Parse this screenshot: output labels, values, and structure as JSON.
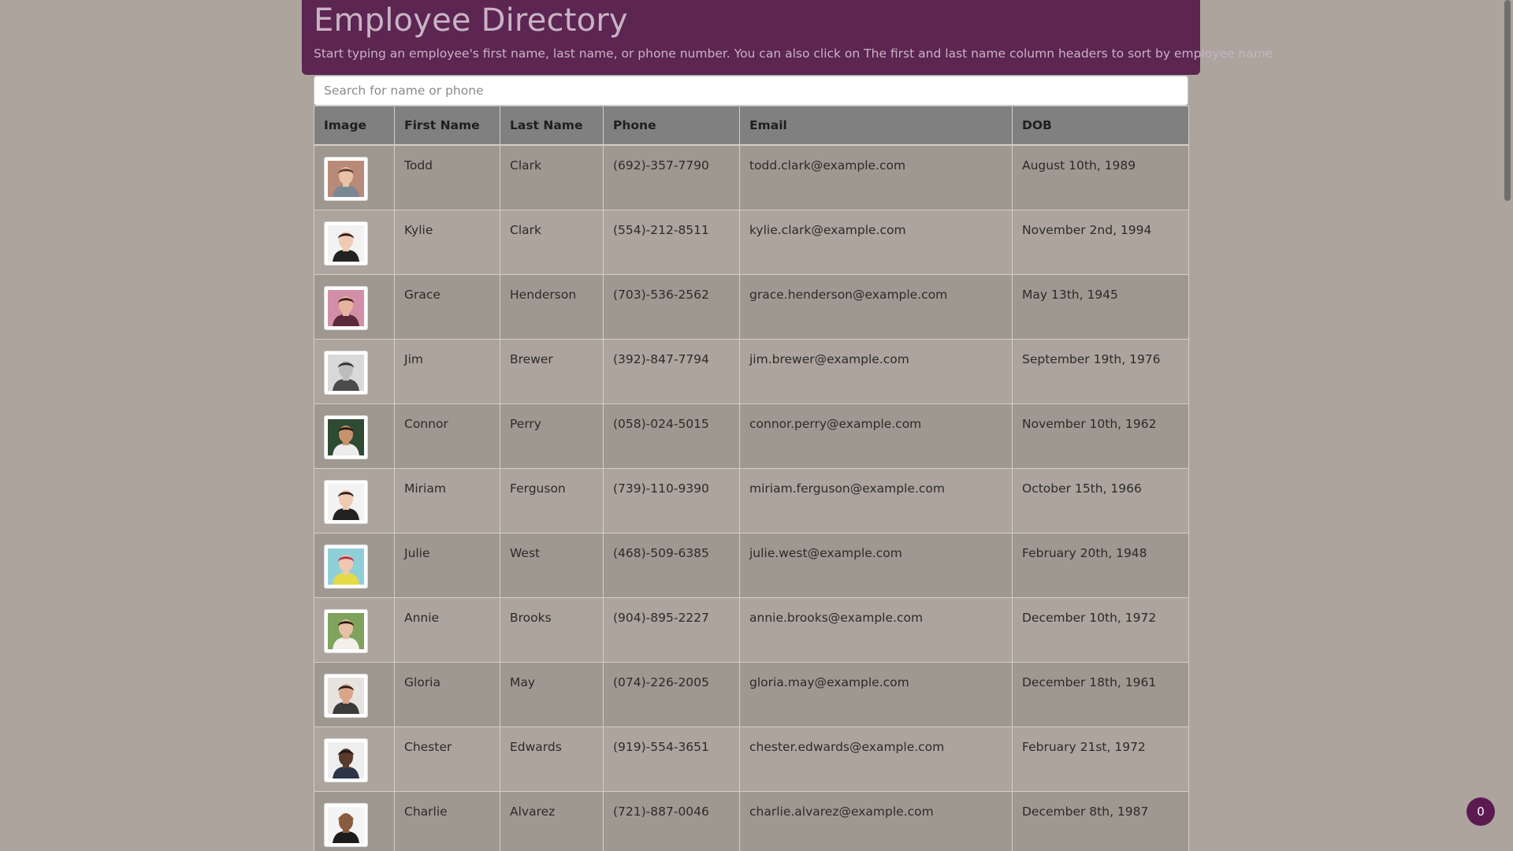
{
  "header": {
    "title": "Employee Directory",
    "subtitle": "Start typing an employee's first name, last name, or phone number. You can also click on The first and last name column headers to sort by employee name"
  },
  "search": {
    "placeholder": "Search for name or phone",
    "value": ""
  },
  "table": {
    "columns": [
      "Image",
      "First Name",
      "Last Name",
      "Phone",
      "Email",
      "DOB"
    ],
    "rows": [
      {
        "first": "Todd",
        "last": "Clark",
        "phone": "(692)-357-7790",
        "email": "todd.clark@example.com",
        "dob": "August 10th, 1989",
        "avatar": {
          "bg": "#b98a78",
          "skin": "#e8c3a8",
          "hair": "#5a3f2c",
          "shirt": "#7b8894"
        }
      },
      {
        "first": "Kylie",
        "last": "Clark",
        "phone": "(554)-212-8511",
        "email": "kylie.clark@example.com",
        "dob": "November 2nd, 1994",
        "avatar": {
          "bg": "#f2f2f2",
          "skin": "#f0c9b3",
          "hair": "#2a1d17",
          "shirt": "#222222"
        }
      },
      {
        "first": "Grace",
        "last": "Henderson",
        "phone": "(703)-536-2562",
        "email": "grace.henderson@example.com",
        "dob": "May 13th, 1945",
        "avatar": {
          "bg": "#d48fa8",
          "skin": "#e6b59f",
          "hair": "#3a2219",
          "shirt": "#5a2a3a"
        }
      },
      {
        "first": "Jim",
        "last": "Brewer",
        "phone": "(392)-847-7794",
        "email": "jim.brewer@example.com",
        "dob": "September 19th, 1976",
        "avatar": {
          "bg": "#d9d9d9",
          "skin": "#bdbdbd",
          "hair": "#2f2f2f",
          "shirt": "#4a4a4a"
        }
      },
      {
        "first": "Connor",
        "last": "Perry",
        "phone": "(058)-024-5015",
        "email": "connor.perry@example.com",
        "dob": "November 10th, 1962",
        "avatar": {
          "bg": "#2f4a32",
          "skin": "#c9926e",
          "hair": "#1e1a17",
          "shirt": "#ececec"
        }
      },
      {
        "first": "Miriam",
        "last": "Ferguson",
        "phone": "(739)-110-9390",
        "email": "miriam.ferguson@example.com",
        "dob": "October 15th, 1966",
        "avatar": {
          "bg": "#f2f2f2",
          "skin": "#f0c9b3",
          "hair": "#2a1d17",
          "shirt": "#222222"
        }
      },
      {
        "first": "Julie",
        "last": "West",
        "phone": "(468)-509-6385",
        "email": "julie.west@example.com",
        "dob": "February 20th, 1948",
        "avatar": {
          "bg": "#8fd0d8",
          "skin": "#f0c7b0",
          "hair": "#b0334d",
          "shirt": "#e6d94a"
        }
      },
      {
        "first": "Annie",
        "last": "Brooks",
        "phone": "(904)-895-2227",
        "email": "annie.brooks@example.com",
        "dob": "December 10th, 1972",
        "avatar": {
          "bg": "#7fa35c",
          "skin": "#e8c0a3",
          "hair": "#2b1d15",
          "shirt": "#f3f0ec"
        }
      },
      {
        "first": "Gloria",
        "last": "May",
        "phone": "(074)-226-2005",
        "email": "gloria.may@example.com",
        "dob": "December 18th, 1961",
        "avatar": {
          "bg": "#e7e4e0",
          "skin": "#d9a58a",
          "hair": "#2d1e1a",
          "shirt": "#3a3a3a"
        }
      },
      {
        "first": "Chester",
        "last": "Edwards",
        "phone": "(919)-554-3651",
        "email": "chester.edwards@example.com",
        "dob": "February 21st, 1972",
        "avatar": {
          "bg": "#eeeeee",
          "skin": "#5a3a28",
          "hair": "#1a1a1a",
          "shirt": "#2c3448"
        }
      },
      {
        "first": "Charlie",
        "last": "Alvarez",
        "phone": "(721)-887-0046",
        "email": "charlie.alvarez@example.com",
        "dob": "December 8th, 1987",
        "avatar": {
          "bg": "#f4f4f4",
          "skin": "#8a5b3e",
          "hair": "#8a5b3e",
          "shirt": "#1c1c1c"
        }
      }
    ]
  },
  "badge": {
    "count": "0",
    "color": "#5c1a50"
  },
  "colors": {
    "header_bg": "#5c2552",
    "header_text": "#c9b3c4",
    "page_bg": "#aca49d",
    "table_head_bg": "#808080"
  }
}
